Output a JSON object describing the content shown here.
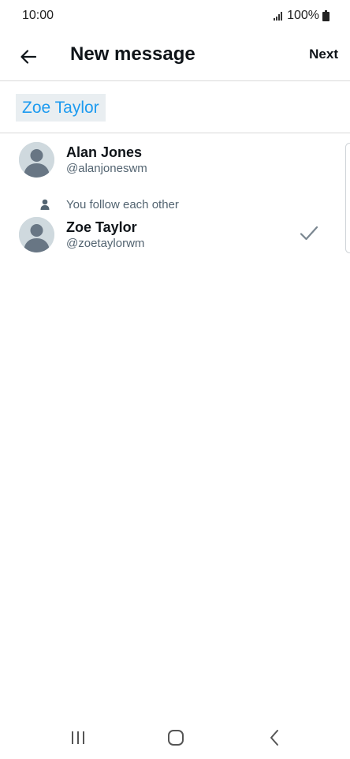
{
  "status_bar": {
    "time": "10:00",
    "battery": "100%",
    "icons": [
      "signal-icon",
      "battery-icon"
    ]
  },
  "header": {
    "title": "New message",
    "next_label": "Next",
    "back_icon": "arrow-left-icon"
  },
  "recipients": {
    "selected": [
      "Zoe Taylor"
    ]
  },
  "results": [
    {
      "name": "Alan Jones",
      "handle": "@alanjoneswm",
      "follow_note": "",
      "selected": false
    },
    {
      "name": "Zoe Taylor",
      "handle": "@zoetaylorwm",
      "follow_note": "You follow each other",
      "selected": true
    }
  ],
  "nav": {
    "items": [
      "recent-apps-icon",
      "home-icon",
      "back-icon"
    ]
  },
  "colors": {
    "accent": "#1d9bf0",
    "chip_background": "#e9eef1",
    "secondary_text": "#536471",
    "avatar_background": "#cfd9de",
    "avatar_figure": "#687684"
  }
}
